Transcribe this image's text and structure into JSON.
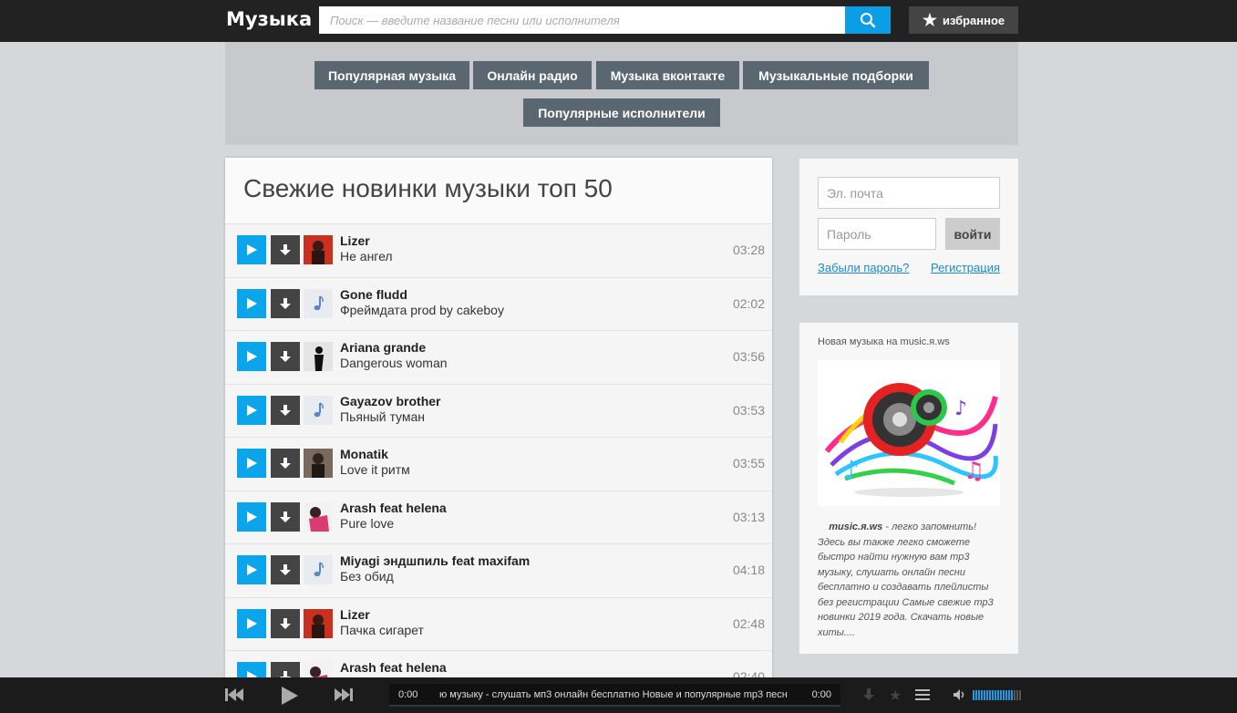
{
  "header": {
    "logo": "Музыка",
    "search_placeholder": "Поиск — введите название песни или исполнителя",
    "favorites_label": "избранное"
  },
  "nav": {
    "items": [
      "Популярная музыка",
      "Онлайн радио",
      "Музыка вконтакте",
      "Музыкальные подборки",
      "Популярные исполнители"
    ]
  },
  "main": {
    "heading": "Свежие новинки музыки топ 50",
    "tracks": [
      {
        "artist": "Lizer",
        "title": "Не ангел",
        "duration": "03:28",
        "thumb": "photo-red"
      },
      {
        "artist": "Gone fludd",
        "title": "Фреймдата prod by cakeboy",
        "duration": "02:02",
        "thumb": "music-note"
      },
      {
        "artist": "Ariana grande",
        "title": "Dangerous woman",
        "duration": "03:56",
        "thumb": "photo-silhouette"
      },
      {
        "artist": "Gayazov brother",
        "title": "Пьяный туман",
        "duration": "03:53",
        "thumb": "music-note"
      },
      {
        "artist": "Monatik",
        "title": "Love it ритм",
        "duration": "03:55",
        "thumb": "photo-dark"
      },
      {
        "artist": "Arash feat helena",
        "title": "Pure love",
        "duration": "03:13",
        "thumb": "photo-pink"
      },
      {
        "artist": "Miyagi эндшпиль feat maxifam",
        "title": "Без обид",
        "duration": "04:18",
        "thumb": "music-note"
      },
      {
        "artist": "Lizer",
        "title": "Пачка сигарет",
        "duration": "02:48",
        "thumb": "photo-red"
      },
      {
        "artist": "Arash feat helena",
        "title": "",
        "duration": "02:40",
        "thumb": "photo-pink"
      }
    ]
  },
  "login": {
    "email_placeholder": "Эл. почта",
    "password_placeholder": "Пароль",
    "submit_label": "войти",
    "forgot_label": "Забыли пароль?",
    "register_label": "Регистрация"
  },
  "info": {
    "heading": "Новая музыка на music.я.ws",
    "site_name": "music.я.ws",
    "description": " - легко запомнить! Здесь вы также легко сможете быстро найти нужную вам mp3 музыку, слушать онлайн песни бесплатно и создавать плейлисты без регистрации Самые свежие mp3 новинки 2019 года. Скачать новые хиты...."
  },
  "player": {
    "time_current": "0:00",
    "time_total": "0:00",
    "ticker_text": "ю музыку - слушать мп3 онлайн бесплатно Новые и популярные mp3 песн",
    "volume_fraction": 0.83
  },
  "colors": {
    "accent": "#0ba5ec",
    "topbar": "#222222",
    "nav_button": "#5a6670",
    "link": "#1a8ad0"
  }
}
